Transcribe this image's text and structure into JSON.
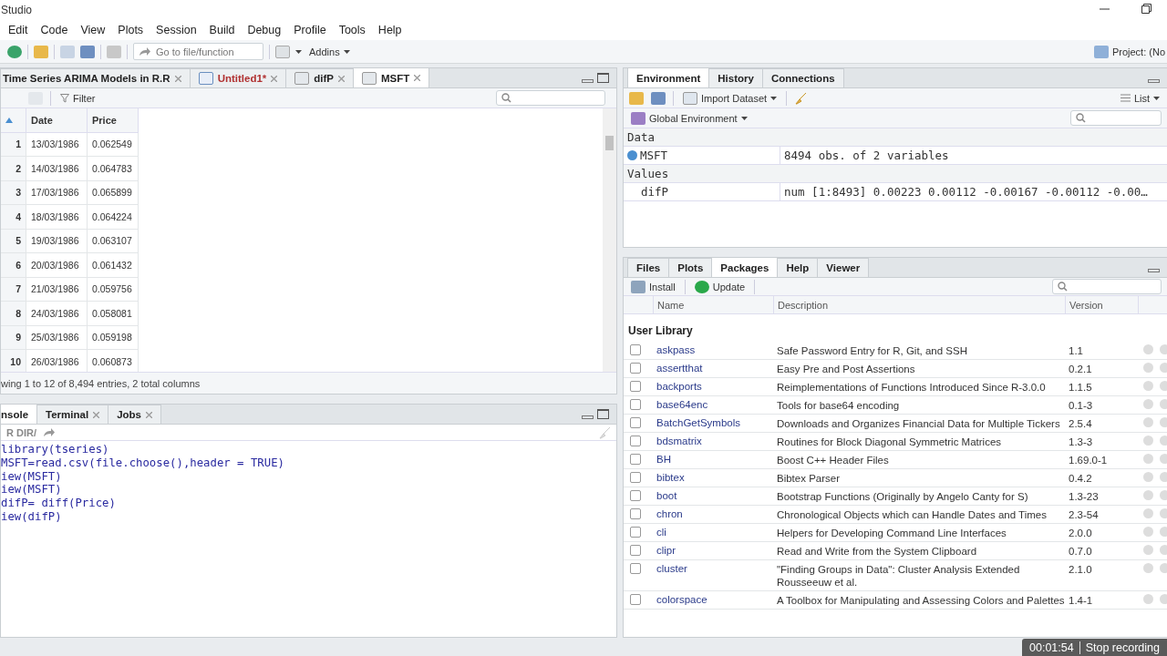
{
  "window": {
    "title": "Studio"
  },
  "menu": [
    "Edit",
    "Code",
    "View",
    "Plots",
    "Session",
    "Build",
    "Debug",
    "Profile",
    "Tools",
    "Help"
  ],
  "toolbar": {
    "goto_placeholder": "Go to file/function",
    "addins": "Addins",
    "project": "Project: (No"
  },
  "source": {
    "tabs": [
      {
        "label": "Time Series ARIMA Models in R.R",
        "kind": "script",
        "modified": false,
        "selected": false
      },
      {
        "label": "Untitled1*",
        "kind": "rscript",
        "modified": true,
        "selected": false
      },
      {
        "label": "difP",
        "kind": "data",
        "modified": false,
        "selected": false
      },
      {
        "label": "MSFT",
        "kind": "data",
        "modified": false,
        "selected": true
      }
    ],
    "filter": "Filter",
    "columns": [
      "",
      "Date",
      "Price"
    ],
    "rows": [
      [
        "1",
        "13/03/1986",
        "0.062549"
      ],
      [
        "2",
        "14/03/1986",
        "0.064783"
      ],
      [
        "3",
        "17/03/1986",
        "0.065899"
      ],
      [
        "4",
        "18/03/1986",
        "0.064224"
      ],
      [
        "5",
        "19/03/1986",
        "0.063107"
      ],
      [
        "6",
        "20/03/1986",
        "0.061432"
      ],
      [
        "7",
        "21/03/1986",
        "0.059756"
      ],
      [
        "8",
        "24/03/1986",
        "0.058081"
      ],
      [
        "9",
        "25/03/1986",
        "0.059198"
      ],
      [
        "10",
        "26/03/1986",
        "0.060873"
      ]
    ],
    "footer": "wing 1 to 12 of 8,494 entries, 2 total columns"
  },
  "console": {
    "tabs": [
      {
        "label": "nsole",
        "closable": false,
        "selected": true
      },
      {
        "label": "Terminal",
        "closable": true,
        "selected": false
      },
      {
        "label": "Jobs",
        "closable": true,
        "selected": false
      }
    ],
    "path": "R DIR/",
    "lines": [
      "library(tseries)",
      "MSFT=read.csv(file.choose(),header = TRUE)",
      "iew(MSFT)",
      "iew(MSFT)",
      "difP= diff(Price)",
      "iew(difP)"
    ]
  },
  "environment": {
    "tabs": [
      {
        "label": "Environment",
        "selected": true
      },
      {
        "label": "History",
        "selected": false
      },
      {
        "label": "Connections",
        "selected": false
      }
    ],
    "import": "Import Dataset",
    "view": "List",
    "scope": "Global Environment",
    "sections": [
      {
        "title": "Data",
        "items": [
          {
            "name": "MSFT",
            "value": "8494 obs. of 2 variables",
            "expandable": true
          }
        ]
      },
      {
        "title": "Values",
        "items": [
          {
            "name": "difP",
            "value": "num [1:8493] 0.00223 0.00112 -0.00167 -0.00112 -0.00…",
            "expandable": false
          }
        ]
      }
    ]
  },
  "packages": {
    "tabs": [
      {
        "label": "Files",
        "selected": false
      },
      {
        "label": "Plots",
        "selected": false
      },
      {
        "label": "Packages",
        "selected": true
      },
      {
        "label": "Help",
        "selected": false
      },
      {
        "label": "Viewer",
        "selected": false
      }
    ],
    "install": "Install",
    "update": "Update",
    "columns": [
      "Name",
      "Description",
      "Version"
    ],
    "library": "User Library",
    "rows": [
      {
        "name": "askpass",
        "description": "Safe Password Entry for R, Git, and SSH",
        "version": "1.1",
        "checked": false
      },
      {
        "name": "assertthat",
        "description": "Easy Pre and Post Assertions",
        "version": "0.2.1",
        "checked": false
      },
      {
        "name": "backports",
        "description": "Reimplementations of Functions Introduced Since R-3.0.0",
        "version": "1.1.5",
        "checked": false
      },
      {
        "name": "base64enc",
        "description": "Tools for base64 encoding",
        "version": "0.1-3",
        "checked": false
      },
      {
        "name": "BatchGetSymbols",
        "description": "Downloads and Organizes Financial Data for Multiple Tickers",
        "version": "2.5.4",
        "checked": false
      },
      {
        "name": "bdsmatrix",
        "description": "Routines for Block Diagonal Symmetric Matrices",
        "version": "1.3-3",
        "checked": false
      },
      {
        "name": "BH",
        "description": "Boost C++ Header Files",
        "version": "1.69.0-1",
        "checked": false
      },
      {
        "name": "bibtex",
        "description": "Bibtex Parser",
        "version": "0.4.2",
        "checked": false
      },
      {
        "name": "boot",
        "description": "Bootstrap Functions (Originally by Angelo Canty for S)",
        "version": "1.3-23",
        "checked": false
      },
      {
        "name": "chron",
        "description": "Chronological Objects which can Handle Dates and Times",
        "version": "2.3-54",
        "checked": false
      },
      {
        "name": "cli",
        "description": "Helpers for Developing Command Line Interfaces",
        "version": "2.0.0",
        "checked": false
      },
      {
        "name": "clipr",
        "description": "Read and Write from the System Clipboard",
        "version": "0.7.0",
        "checked": false
      },
      {
        "name": "cluster",
        "description": "\"Finding Groups in Data\": Cluster Analysis Extended Rousseeuw et al.",
        "version": "2.1.0",
        "checked": false
      },
      {
        "name": "colorspace",
        "description": "A Toolbox for Manipulating and Assessing Colors and Palettes",
        "version": "1.4-1",
        "checked": false
      }
    ]
  },
  "recording": {
    "time": "00:01:54",
    "action": "Stop recording"
  }
}
